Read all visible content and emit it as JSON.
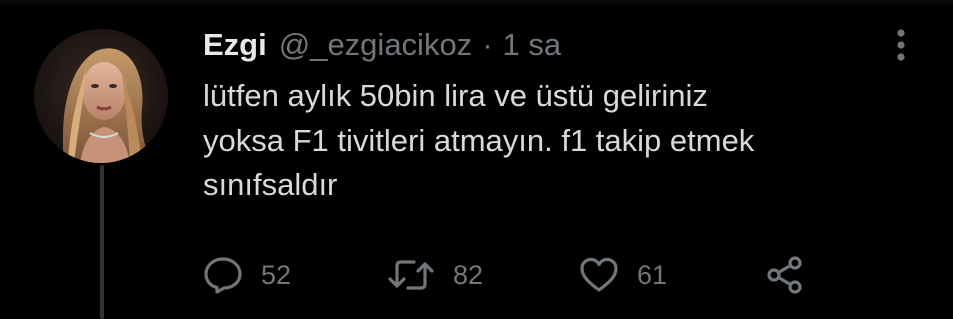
{
  "tweet": {
    "display_name": "Ezgi",
    "handle": "@_ezgiacikoz",
    "separator": "·",
    "time": "1 sa",
    "text": "lütfen aylık 50bin lira ve üstü geliriniz\nyoksa F1 tivitleri atmayın. f1 takip etmek\nsınıfsaldır",
    "avatar_icon": "profile-photo"
  },
  "actions": {
    "reply": {
      "icon": "reply-icon",
      "count": "52"
    },
    "retweet": {
      "icon": "retweet-icon",
      "count": "82"
    },
    "like": {
      "icon": "heart-icon",
      "count": "61"
    },
    "share": {
      "icon": "share-icon"
    }
  },
  "menu": {
    "icon": "more-vertical-icon"
  },
  "colors": {
    "background": "#000000",
    "text": "#d9d9d9",
    "secondary": "#71767b",
    "thread_line": "#2f3336"
  }
}
